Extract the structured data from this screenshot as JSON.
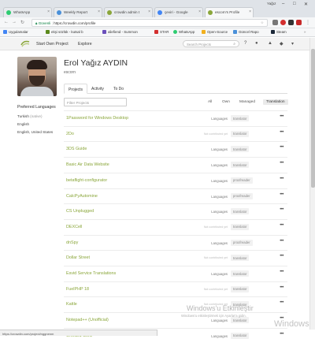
{
  "browser": {
    "tabs": [
      {
        "label": "WhatsApp",
        "favicon_color": "#2ecc71"
      },
      {
        "label": "Weekly Report",
        "favicon_color": "#4a90d9"
      },
      {
        "label": "crowdin admin t",
        "favicon_color": "#8aa63a"
      },
      {
        "label": "çeviri - Google",
        "favicon_color": "#4285f4"
      },
      {
        "label": "escorn's Profile",
        "favicon_color": "#8aa63a"
      }
    ],
    "user_label": "Yağız",
    "security_label": "Güvenli",
    "url": "https://crowdin.com/profile",
    "bookmarks": [
      {
        "label": "Uygulamalar",
        "color": "#4285f4"
      },
      {
        "label": "ekşi sözlük - kutsal b",
        "color": "#5c8a1c"
      },
      {
        "label": "aliefiend - Summon",
        "color": "#6b4fbb"
      },
      {
        "label": "STAR",
        "color": "#d32f2f"
      },
      {
        "label": "WhatsApp",
        "color": "#2ecc71"
      },
      {
        "label": "Open-Source",
        "color": "#f2b01e"
      },
      {
        "label": "Güncel Rapo",
        "color": "#4a90d9"
      },
      {
        "label": "Steam",
        "color": "#1b2838"
      }
    ],
    "status_url": "https://crowdin.com/project/nggnenm"
  },
  "site": {
    "nav": [
      "Start Own Project",
      "Explore"
    ],
    "search_placeholder": "Search Projects",
    "brand_color": "#8aa63a"
  },
  "profile": {
    "name": "Erol Yağız AYDIN",
    "username": "escorn",
    "tabs": [
      "Projects",
      "Activity",
      "To Do"
    ],
    "active_tab": "Projects",
    "languages_title": "Preferred Languages",
    "languages": [
      {
        "name": "Turkish",
        "note": "(native)"
      },
      {
        "name": "English",
        "note": ""
      },
      {
        "name": "English, United States",
        "note": ""
      }
    ]
  },
  "projects": {
    "filter_placeholder": "Filter Projects",
    "filters": [
      "All",
      "Own",
      "Managed",
      "Translation"
    ],
    "selected_filter": "Translation",
    "items": [
      {
        "title": "1Password for Windows Desktop",
        "kind": "Languages",
        "faint": false,
        "role": "translator"
      },
      {
        "title": "2Do",
        "kind": "Not contributed yet",
        "faint": true,
        "role": "translator"
      },
      {
        "title": "3DS Guide",
        "kind": "Languages",
        "faint": false,
        "role": "translator"
      },
      {
        "title": "Basic Air Data Website",
        "kind": "Languages",
        "faint": false,
        "role": "translator"
      },
      {
        "title": "betaflight-configurator",
        "kind": "Languages",
        "faint": false,
        "role": "proofreader"
      },
      {
        "title": "CalcPyAutomine",
        "kind": "Languages",
        "faint": false,
        "role": "proofreader"
      },
      {
        "title": "CS Unplugged",
        "kind": "Languages",
        "faint": false,
        "role": "translator"
      },
      {
        "title": "DEXCell",
        "kind": "Not contributed yet",
        "faint": true,
        "role": "translator"
      },
      {
        "title": "dnSpy",
        "kind": "Languages",
        "faint": false,
        "role": "proofreader"
      },
      {
        "title": "Dollar Street",
        "kind": "Not contributed yet",
        "faint": true,
        "role": "translator"
      },
      {
        "title": "Esvid Service Translations",
        "kind": "Languages",
        "faint": false,
        "role": "translator"
      },
      {
        "title": "FuelPHP 18",
        "kind": "Not contributed yet",
        "faint": true,
        "role": "translator"
      },
      {
        "title": "Kattle",
        "kind": "Not contributed yet",
        "faint": true,
        "role": "translator"
      },
      {
        "title": "Notepad++ (Unofficial)",
        "kind": "Languages",
        "faint": false,
        "role": "translator"
      },
      {
        "title": "Orchard CMS",
        "kind": "Languages",
        "faint": false,
        "role": "translator"
      }
    ]
  },
  "watermark": {
    "line1": "Windows'u Etkinleştir",
    "line2": "Windows'u etkinleştirmek için Ayarlar'a gidin.",
    "line3": "Windows"
  }
}
